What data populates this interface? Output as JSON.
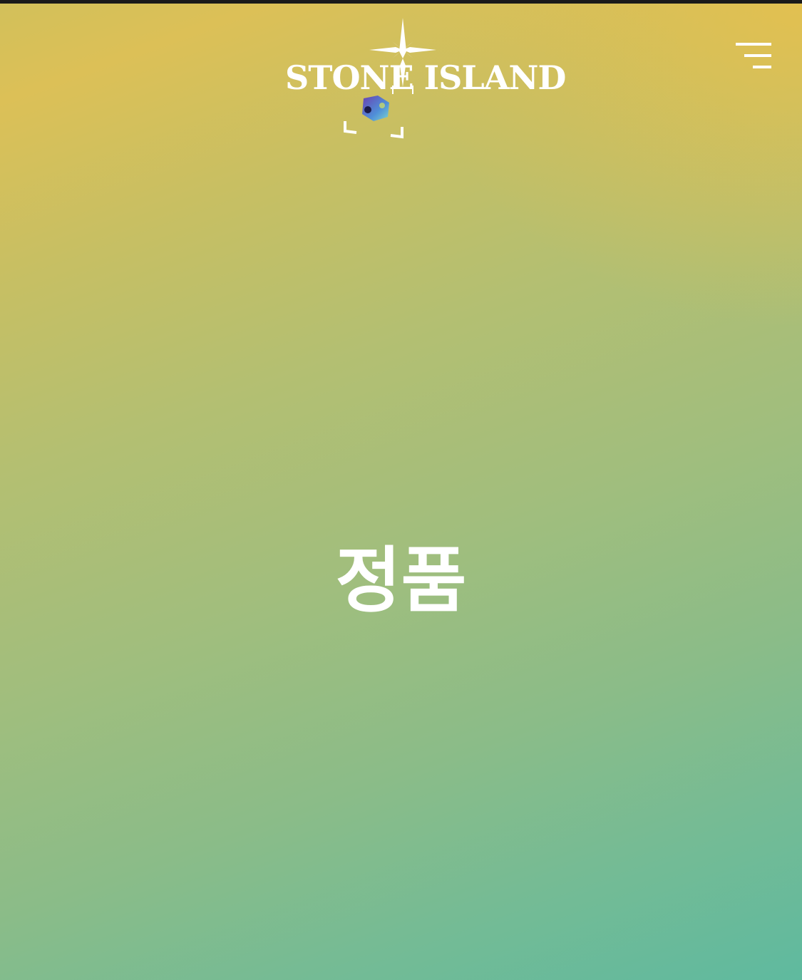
{
  "header": {
    "brand": "STONE ISLAND",
    "menu_icon": "hamburger-menu-icon",
    "logo_icon": "compass-star-icon"
  },
  "main": {
    "title": "정품"
  },
  "overlay": {
    "ar_icon": "ar-scan-icon"
  },
  "colors": {
    "gradient_top": "#dcc057",
    "gradient_middle": "#a1be7d",
    "gradient_bottom": "#5fba9f",
    "logo_color": "#ffffff",
    "text_color": "#ffffff"
  }
}
